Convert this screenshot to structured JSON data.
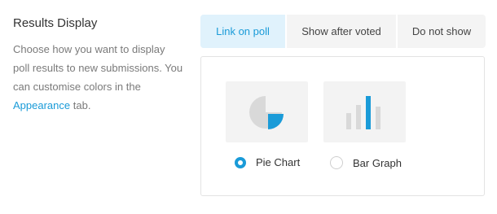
{
  "section": {
    "title": "Results Display",
    "description": "Choose how you want to display poll results to new submissions. You can customise colors in the",
    "link_text": "Appearance",
    "description_suffix": "tab."
  },
  "tabs": [
    {
      "label": "Link on poll",
      "active": true
    },
    {
      "label": "Show after voted",
      "active": false
    },
    {
      "label": "Do not show",
      "active": false
    }
  ],
  "chart_options": [
    {
      "label": "Pie Chart",
      "icon": "pie-chart-icon",
      "selected": true
    },
    {
      "label": "Bar Graph",
      "icon": "bar-graph-icon",
      "selected": false
    }
  ],
  "colors": {
    "accent": "#1a9bd8",
    "icon_gray": "#d9d9d9",
    "active_tab_bg": "#e0f2fc",
    "inactive_tab_bg": "#f4f4f4"
  }
}
